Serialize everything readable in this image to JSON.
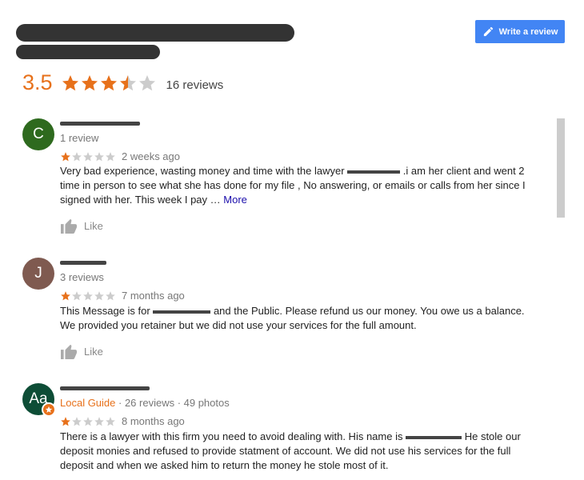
{
  "header": {
    "write_review_label": "Write a review",
    "write_review_icon": "pencil-icon",
    "accent": "#4285f4"
  },
  "summary": {
    "rating": "3.5",
    "rating_value": 3.5,
    "stars_max": 5,
    "review_count": "16 reviews",
    "rating_color": "#e7711b"
  },
  "reviews": [
    {
      "avatar_letter": "C",
      "avatar_color": "#2e6a1e",
      "meta": "1 review",
      "stars": 1,
      "time": "2 weeks ago",
      "text_a": "Very bad experience, wasting money and time with the lawyer",
      "text_b": ".i am her client and went 2 time in person to see what she has done for my file , No answering, or emails or calls from her since I signed with her.   This week I pay …",
      "more": "More",
      "like": "Like"
    },
    {
      "avatar_letter": "J",
      "avatar_color": "#7f5a50",
      "meta": "3 reviews",
      "stars": 1,
      "time": "7 months ago",
      "text_a": "This Message is for",
      "text_b": "and the Public. Please refund us our money. You owe us a balance. We provided you retainer but we did not use your services for the full amount.",
      "like": "Like"
    },
    {
      "avatar_letter": "Aa",
      "avatar_color": "#0d4d36",
      "guide_label": "Local Guide",
      "meta": " · 26 reviews · 49 photos",
      "stars": 1,
      "time": "8 months ago",
      "text_a": "There is a lawyer with this firm you need to avoid dealing with. His name is",
      "text_b": "He stole our deposit monies and refused to provide statment of account. We did not use his services for the full deposit and when we asked  him to return the money he stole most of it."
    }
  ]
}
